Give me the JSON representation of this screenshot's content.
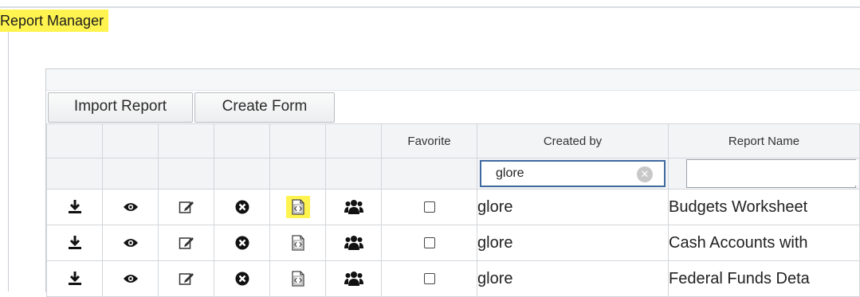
{
  "app": {
    "title": "Report Manager"
  },
  "toolbar": {
    "import_label": "Import Report",
    "create_label": "Create Form"
  },
  "grid": {
    "headers": {
      "favorite": "Favorite",
      "created_by": "Created by",
      "report_name": "Report Name"
    },
    "filters": {
      "created_by_value": "glore",
      "report_name_value": ""
    },
    "rows": [
      {
        "created_by": "glore",
        "report_name": "Budgets Worksheet",
        "favorite": false
      },
      {
        "created_by": "glore",
        "report_name": "Cash Accounts with",
        "favorite": false
      },
      {
        "created_by": "glore",
        "report_name": "Federal Funds Deta",
        "favorite": false
      }
    ]
  },
  "icons": [
    "download-icon",
    "view-icon",
    "edit-icon",
    "delete-icon",
    "code-file-icon",
    "users-icon"
  ],
  "colors": {
    "highlight": "#fff44f",
    "filter_border": "#3f6aa0",
    "grid_border": "#d2d6db"
  }
}
